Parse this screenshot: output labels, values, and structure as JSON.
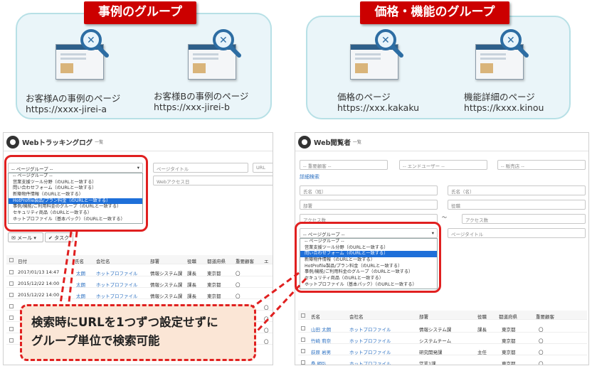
{
  "groups": [
    {
      "title": "事例のグループ",
      "pages": [
        {
          "label": "お客様Aの事例のページ",
          "url": "https://xxxx-jirei-a"
        },
        {
          "label": "お客様Bの事例のページ",
          "url": "https://xxx-jirei-b"
        }
      ]
    },
    {
      "title": "価格・機能のグループ",
      "pages": [
        {
          "label": "価格のページ",
          "url": "https://xxx.kakaku"
        },
        {
          "label": "機能詳細のページ",
          "url": "https://kxxx.kinou"
        }
      ]
    }
  ],
  "left_panel": {
    "title": "Webトラッキングログ",
    "subtitle": "一覧",
    "select": "-- ページグループ --",
    "inputs": [
      "ページタイトル",
      "URL",
      "Webアクセス日"
    ],
    "dropdown": [
      "-- ページグループ --",
      "営業支援ツール分野（のURLと一致する）",
      "問い合わせフォーム（のURLと一致する）",
      "新築物件情報（のURLと一致する）",
      "HotProfile製品/プラン料金（のURLと一致する）",
      "事例/機能/ご利用料金のグループ（のURLと一致する）",
      "セキュリティ商品（のURLと一致する）",
      "ホットプロファイル（基本パック）（のURLと一致する）"
    ],
    "buttons": [
      "メール",
      "タスク"
    ],
    "headers": [
      "日付",
      "氏名",
      "会社名",
      "部署",
      "役職",
      "都道府県",
      "重要顧客",
      "エ"
    ],
    "rows": [
      [
        "2017/01/13 14:47",
        "太朗",
        "ホットプロファイル",
        "情報システム課",
        "課長",
        "東京都"
      ],
      [
        "2015/12/22 14:00",
        "太朗",
        "ホットプロファイル",
        "情報システム課",
        "課長",
        "東京都"
      ],
      [
        "2015/12/22 14:00",
        "太朗",
        "ホットプロファイル",
        "情報システム課",
        "課長",
        "東京都"
      ],
      [
        "",
        "",
        "",
        "",
        "",
        ""
      ],
      [
        "",
        "",
        "",
        "",
        "",
        ""
      ],
      [
        "",
        "",
        "",
        "",
        "",
        ""
      ],
      [
        "",
        "",
        "",
        "",
        "",
        ""
      ]
    ]
  },
  "right_panel": {
    "title": "Web閲覧者",
    "subtitle": "一覧",
    "filters": [
      "-- 重要顧客 --",
      "-- エンドユーザー --",
      "-- 販売店 --"
    ],
    "detail_link": "詳細検索",
    "inputs": [
      "氏名（姓）",
      "氏名（名）",
      "部署",
      "役職",
      "アクセス数",
      "アクセス数",
      "ページタイトル"
    ],
    "tilde": "〜",
    "select": "-- ページグループ --",
    "dropdown": [
      "-- ページグループ --",
      "営業支援ツール分野（のURLと一致する）",
      "問い合わせフォーム（のURLと一致する）",
      "新築物件情報（のURLと一致する）",
      "HotProfile製品/プラン料金（のURLと一致する）",
      "事例/機能/ご利用料金のグループ（のURLと一致する）",
      "セキュリティ商品（のURLと一致する）",
      "ホットプロファイル（基本パック）（のURLと一致する）"
    ],
    "headers": [
      "氏名",
      "会社名",
      "部署",
      "役職",
      "都道府県",
      "重要顧客"
    ],
    "rows": [
      [
        "山田 太朗",
        "ホットプロファイル",
        "情報システム課",
        "課長",
        "東京都",
        "〇"
      ],
      [
        "竹崎 莉奈",
        "ホットプロファイル",
        "システムチーム",
        "",
        "東京都",
        "〇"
      ],
      [
        "荻原 岩男",
        "ホットプロファイル",
        "研究開発課",
        "主任",
        "東京都",
        "〇"
      ],
      [
        "桑 明弘",
        "ホットプロファイル",
        "営業1課",
        "",
        "東京都",
        "〇"
      ]
    ]
  },
  "callout": {
    "line1": "検索時にURLを1つずつ設定せずに",
    "line2": "グループ単位で検索可能"
  }
}
